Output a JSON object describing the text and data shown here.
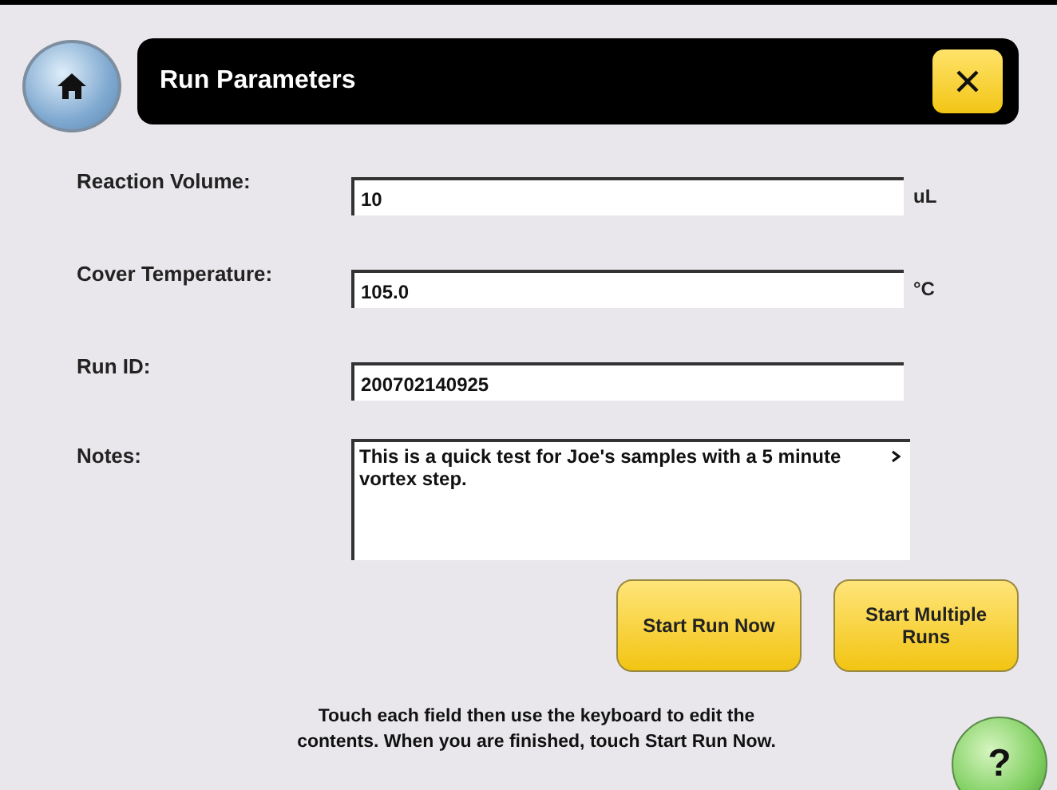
{
  "header": {
    "title": "Run Parameters"
  },
  "fields": [
    {
      "label": "Reaction Volume:",
      "value": "10",
      "unit": "uL",
      "kind": "line"
    },
    {
      "label": "Cover Temperature:",
      "value": "105.0",
      "unit": "°C",
      "kind": "line"
    },
    {
      "label": "Run ID:",
      "value": "200702140925",
      "kind": "line"
    },
    {
      "label": "Notes:",
      "value": "This is a quick test for Joe's samples with a 5 minute vortex step.",
      "kind": "area"
    }
  ],
  "buttons": [
    {
      "label": "Start Run Now"
    },
    {
      "label": "Start Multiple Runs"
    }
  ],
  "instructions": "Touch each field then use the keyboard to edit the contents. When you are finished, touch Start Run Now.",
  "help": "?"
}
